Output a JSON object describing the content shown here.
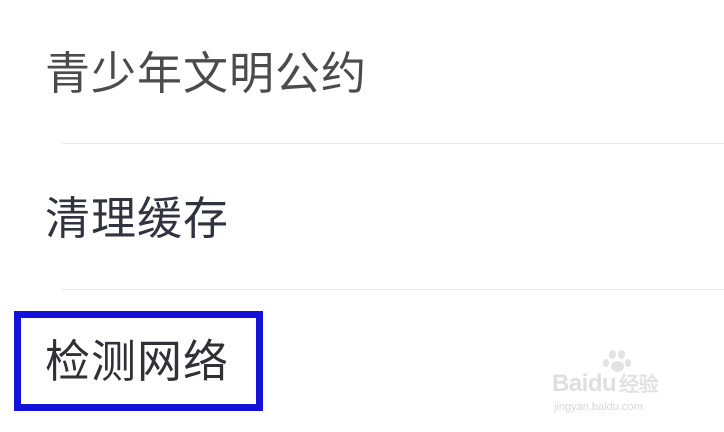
{
  "settings": {
    "items": [
      {
        "label": "青少年文明公约"
      },
      {
        "label": "清理缓存"
      },
      {
        "label": "检测网络",
        "highlighted": true
      }
    ]
  },
  "annotation": {
    "highlight_color": "#1412d8"
  },
  "watermark": {
    "brand": "Baidu",
    "brand_suffix": "经验",
    "url": "jingyan.baidu.com",
    "icon": "paw-icon"
  }
}
